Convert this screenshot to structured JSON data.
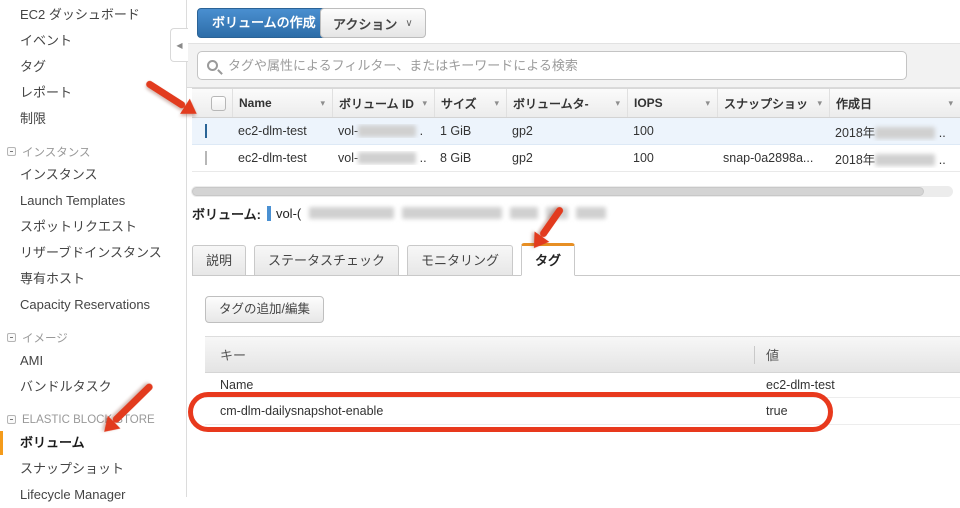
{
  "icons": {
    "sort": "▾",
    "chevron_down": "∨",
    "collapse_sidebar": "◀"
  },
  "colors": {
    "primary_button": "#3079c3",
    "active_tab_accent": "#e78f24",
    "sidebar_selected_bar": "#f49b1b",
    "annotation_red": "#e8391d",
    "selected_row_bg": "#edf4fc"
  },
  "sidebar": {
    "items": [
      {
        "label": "EC2 ダッシュボード"
      },
      {
        "label": "イベント"
      },
      {
        "label": "タグ"
      },
      {
        "label": "レポート"
      },
      {
        "label": "制限"
      },
      {
        "label": "インスタンス",
        "type": "section"
      },
      {
        "label": "インスタンス"
      },
      {
        "label": "Launch Templates"
      },
      {
        "label": "スポットリクエスト"
      },
      {
        "label": "リザーブドインスタンス"
      },
      {
        "label": "専有ホスト"
      },
      {
        "label": "Capacity Reservations"
      },
      {
        "label": "イメージ",
        "type": "section"
      },
      {
        "label": "AMI"
      },
      {
        "label": "バンドルタスク"
      },
      {
        "label": "ELASTIC BLOCK STORE",
        "type": "section"
      },
      {
        "label": "ボリューム",
        "selected": true
      },
      {
        "label": "スナップショット"
      },
      {
        "label": "Lifecycle Manager"
      }
    ]
  },
  "toolbar": {
    "create_volume": "ボリュームの作成",
    "actions": "アクション"
  },
  "search": {
    "placeholder": "タグや属性によるフィルター、またはキーワードによる検索"
  },
  "volumes": {
    "columns": [
      "Name",
      "ボリューム ID",
      "サイズ",
      "ボリュームタ-",
      "IOPS",
      "スナップショッ",
      "作成日"
    ],
    "rows": [
      {
        "name": "ec2-dlm-test",
        "id_prefix": "vol-",
        "id_suffix": ".",
        "size": "1 GiB",
        "type": "gp2",
        "iops": "100",
        "snapshot": "",
        "date_prefix": "2018年",
        "date_suffix": "..",
        "selected": true
      },
      {
        "name": "ec2-dlm-test",
        "id_prefix": "vol-",
        "id_suffix": "..",
        "size": "8 GiB",
        "type": "gp2",
        "iops": "100",
        "snapshot": "snap-0a2898a...",
        "date_prefix": "2018年",
        "date_suffix": "..",
        "selected": false
      }
    ]
  },
  "detail": {
    "label": "ボリューム:",
    "id_prefix": "vol-(",
    "tabs": [
      "説明",
      "ステータスチェック",
      "モニタリング",
      "タグ"
    ],
    "active_tab": "タグ",
    "add_tags_button": "タグの追加/編集",
    "tags": {
      "key_header": "キー",
      "value_header": "値",
      "rows": [
        {
          "key": "Name",
          "value": "ec2-dlm-test"
        },
        {
          "key": "cm-dlm-dailysnapshot-enable",
          "value": "true",
          "highlighted": true
        }
      ]
    }
  }
}
